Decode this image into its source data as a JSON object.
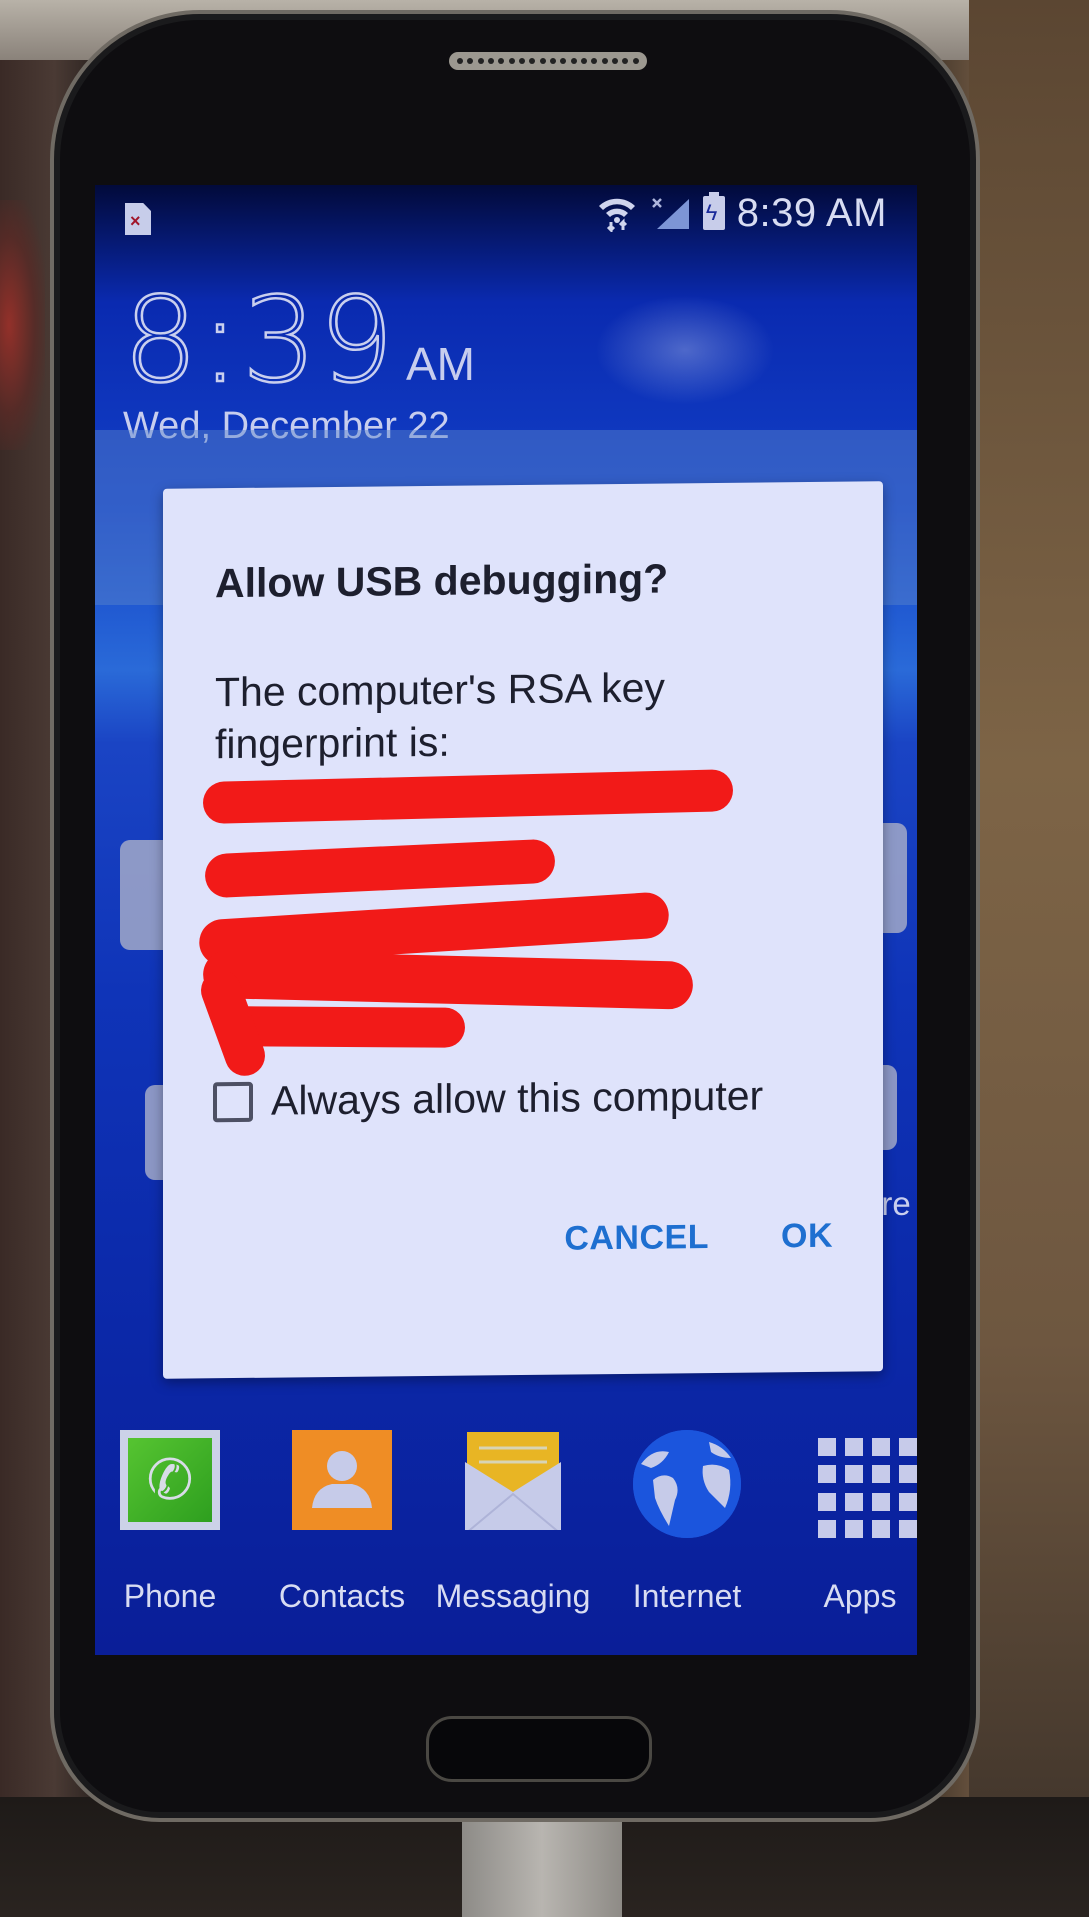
{
  "status_bar": {
    "left_icon": "sim-missing-icon",
    "icons": [
      "wifi-icon",
      "no-signal-icon",
      "battery-charging-icon"
    ],
    "time": "8:39 AM"
  },
  "lock_screen": {
    "clock_time": "8:39",
    "clock_ampm": "AM",
    "date": "Wed, December 22",
    "partial_label": "ore"
  },
  "dialog": {
    "title": "Allow USB debugging?",
    "message": "The computer's RSA key fingerprint is:",
    "fingerprint": "[redacted]",
    "checkbox_label": "Always allow this computer",
    "checkbox_checked": false,
    "cancel_label": "CANCEL",
    "ok_label": "OK",
    "accent_color": "#1e6fd0"
  },
  "dock": {
    "items": [
      {
        "label": "Phone",
        "icon": "phone-icon"
      },
      {
        "label": "Contacts",
        "icon": "contacts-icon"
      },
      {
        "label": "Messaging",
        "icon": "messaging-icon"
      },
      {
        "label": "Internet",
        "icon": "globe-icon"
      },
      {
        "label": "Apps",
        "icon": "apps-grid-icon"
      }
    ]
  },
  "colors": {
    "redaction": "#f21a18",
    "wallpaper": "#0f34b8"
  }
}
